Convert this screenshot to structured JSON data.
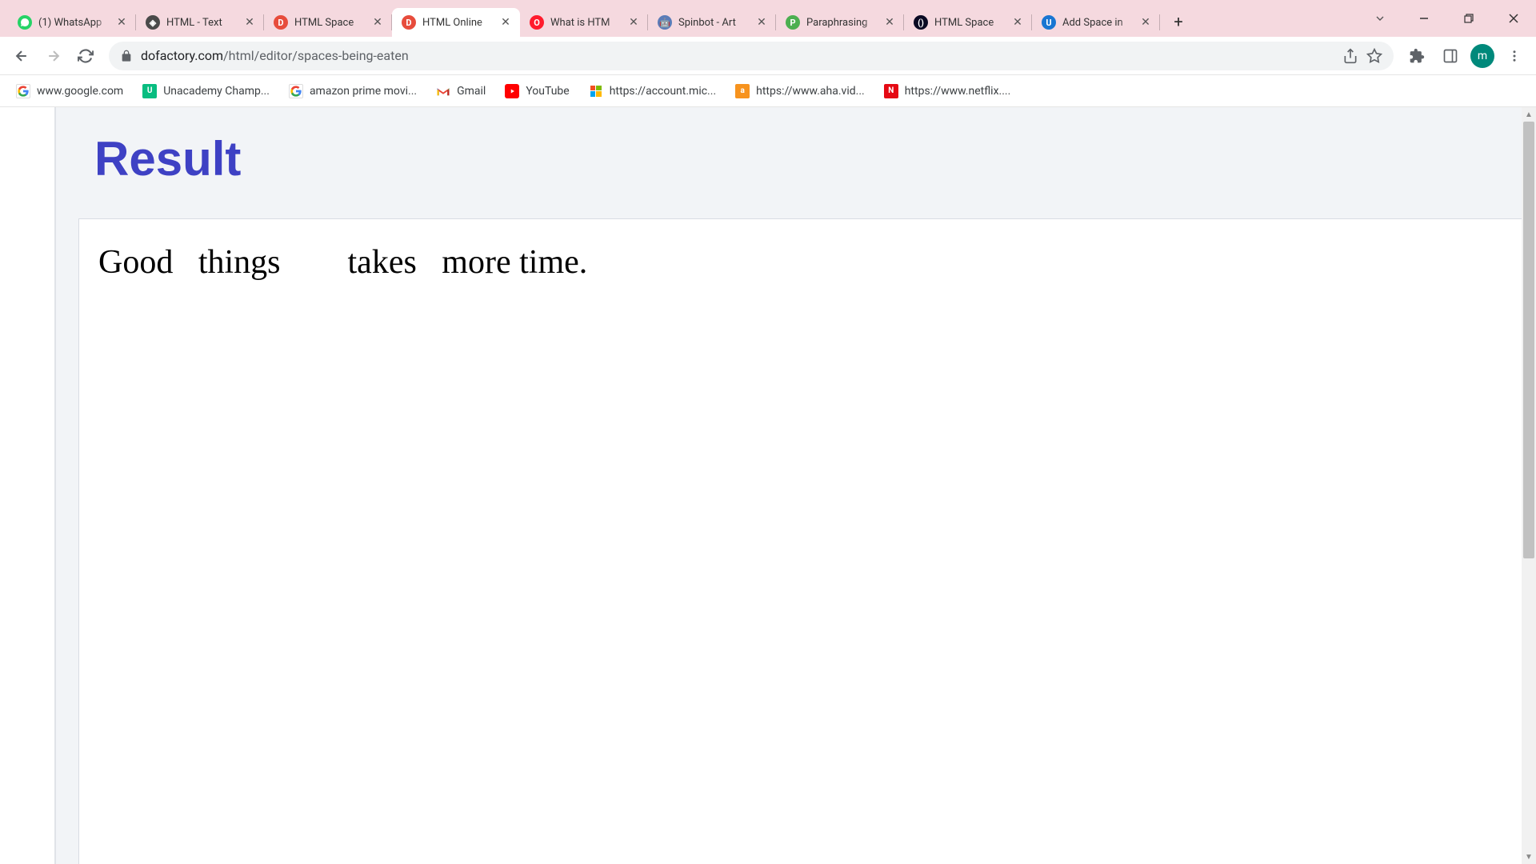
{
  "tabs": [
    {
      "title": "(1) WhatsApp",
      "favicon": "whatsapp",
      "active": false
    },
    {
      "title": "HTML - Text",
      "favicon": "diamond",
      "active": false
    },
    {
      "title": "HTML Space",
      "favicon": "dofactory",
      "active": false
    },
    {
      "title": "HTML Online",
      "favicon": "dofactory",
      "active": true
    },
    {
      "title": "What is HTM",
      "favicon": "opera",
      "active": false
    },
    {
      "title": "Spinbot - Art",
      "favicon": "spinbot",
      "active": false
    },
    {
      "title": "Paraphrasing",
      "favicon": "paraphrase",
      "active": false
    },
    {
      "title": "HTML Space",
      "favicon": "freecodecamp",
      "active": false
    },
    {
      "title": "Add Space in",
      "favicon": "upgrad",
      "active": false
    }
  ],
  "url": {
    "domain": "dofactory.com",
    "path": "/html/editor/spaces-being-eaten"
  },
  "bookmarks": [
    {
      "label": "www.google.com",
      "icon": "google"
    },
    {
      "label": "Unacademy Champ...",
      "icon": "unacademy"
    },
    {
      "label": "amazon prime movi...",
      "icon": "google"
    },
    {
      "label": "Gmail",
      "icon": "gmail"
    },
    {
      "label": "YouTube",
      "icon": "youtube"
    },
    {
      "label": "https://account.mic...",
      "icon": "microsoft"
    },
    {
      "label": "https://www.aha.vid...",
      "icon": "aha"
    },
    {
      "label": "https://www.netflix....",
      "icon": "netflix"
    }
  ],
  "profile": {
    "initial": "m"
  },
  "page": {
    "result_heading": "Result",
    "result_text": "Good   things        takes   more time."
  }
}
